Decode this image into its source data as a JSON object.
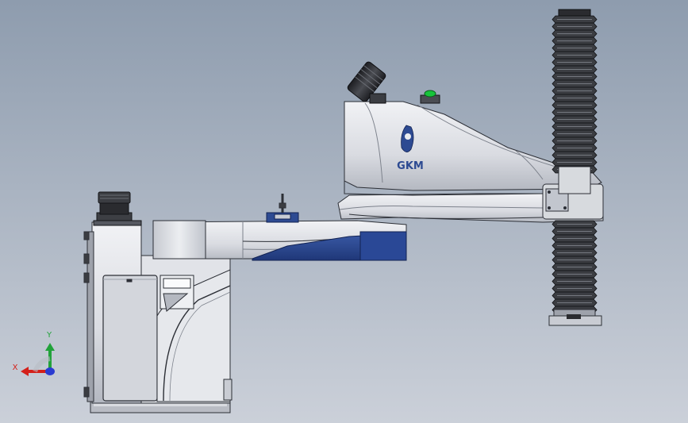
{
  "viewport": {
    "background_top": "#8e9cae",
    "background_bottom": "#cbd0d9"
  },
  "model": {
    "brand_logo_text": "GKM",
    "colors": {
      "body_light": "#e9ebef",
      "body_mid": "#c9ccd4",
      "body_shadow": "#a7abb4",
      "accent_blue": "#2d4a92",
      "dark_parts": "#2a2b2f",
      "edge": "#2c2f36",
      "indicator_green": "#17c43a"
    },
    "icons": [
      "camera-lens-icon",
      "gear-motor-icon",
      "indicator-light-icon"
    ]
  },
  "triad": {
    "x_label": "X",
    "y_label": "Y",
    "x_color": "#d4201a",
    "y_color": "#21a23a",
    "z_color": "#2a3bd1"
  }
}
